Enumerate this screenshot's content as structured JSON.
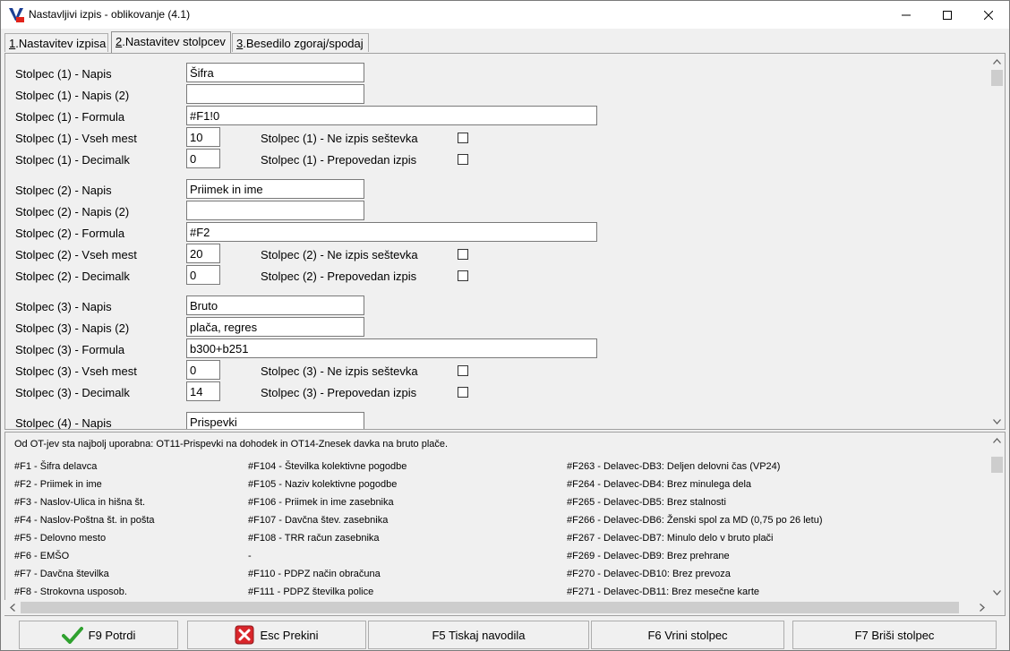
{
  "window": {
    "title": "Nastavljivi izpis - oblikovanje  (4.1)"
  },
  "tabs": [
    {
      "num": "1",
      "label": ".Nastavitev izpisa"
    },
    {
      "num": "2",
      "label": ".Nastavitev stolpcev"
    },
    {
      "num": "3",
      "label": ".Besedilo zgoraj/spodaj"
    }
  ],
  "columns": [
    {
      "napis_label": "Stolpec (1) - Napis",
      "napis": "Šifra",
      "napis2_label": "Stolpec (1) - Napis (2)",
      "napis2": "",
      "formula_label": "Stolpec (1) - Formula",
      "formula": "#F1!0",
      "mest_label": "Stolpec (1) - Vseh mest",
      "mest": "10",
      "decimalk_label": "Stolpec (1) - Decimalk",
      "decimalk": "0",
      "ne_izpis_label": "Stolpec (1) - Ne izpis seštevka",
      "prepovedan_label": "Stolpec (1) - Prepovedan izpis"
    },
    {
      "napis_label": "Stolpec (2) - Napis",
      "napis": "Priimek in ime",
      "napis2_label": "Stolpec (2) - Napis (2)",
      "napis2": "",
      "formula_label": "Stolpec (2) - Formula",
      "formula": "#F2",
      "mest_label": "Stolpec (2) - Vseh mest",
      "mest": "20",
      "decimalk_label": "Stolpec (2) - Decimalk",
      "decimalk": "0",
      "ne_izpis_label": "Stolpec (2) - Ne izpis seštevka",
      "prepovedan_label": "Stolpec (2) - Prepovedan izpis"
    },
    {
      "napis_label": "Stolpec (3) - Napis",
      "napis": "Bruto",
      "napis2_label": "Stolpec (3) - Napis (2)",
      "napis2": "plača, regres",
      "formula_label": "Stolpec (3) - Formula",
      "formula": "b300+b251",
      "mest_label": "Stolpec (3) - Vseh mest",
      "mest": "0",
      "decimalk_label": "Stolpec (3) - Decimalk",
      "decimalk": "14",
      "ne_izpis_label": "Stolpec (3) - Ne izpis seštevka",
      "prepovedan_label": "Stolpec (3) - Prepovedan izpis"
    },
    {
      "napis_label": "Stolpec (4) - Napis",
      "napis": "Prispevki"
    }
  ],
  "help": {
    "title": "Od OT-jev sta najbolj uporabna: OT11-Prispevki na dohodek in OT14-Znesek davka na bruto plače.",
    "col1": [
      "#F1 - Šifra delavca",
      "#F2 - Priimek in ime",
      "#F3 - Naslov-Ulica in hišna št.",
      "#F4 - Naslov-Poštna št. in pošta",
      "#F5 - Delovno mesto",
      "#F6 - EMŠO",
      "#F7 - Davčna številka",
      "#F8 - Strokovna usposob."
    ],
    "col2": [
      "#F104 - Številka kolektivne pogodbe",
      "#F105 - Naziv kolektivne pogodbe",
      "#F106 - Priimek in ime zasebnika",
      "#F107 - Davčna štev. zasebnika",
      "#F108 - TRR račun zasebnika",
      "-",
      "#F110 - PDPZ način obračuna",
      "#F111 - PDPZ številka police"
    ],
    "col3": [
      "#F263 - Delavec-DB3: Deljen delovni čas (VP24)",
      "#F264 - Delavec-DB4: Brez minulega dela",
      "#F265 - Delavec-DB5: Brez stalnosti",
      "#F266 - Delavec-DB6: Ženski spol za MD (0,75 po 26 letu)",
      "#F267 - Delavec-DB7: Minulo delo v bruto plači",
      "#F269 - Delavec-DB9: Brez prehrane",
      "#F270 - Delavec-DB10: Brez prevoza",
      "#F271 - Delavec-DB11: Brez mesečne karte"
    ]
  },
  "buttons": {
    "potrdi": "F9 Potrdi",
    "prekini": "Esc Prekini",
    "tiskaj": "F5 Tiskaj navodila",
    "vrini": "F6  Vrini stolpec",
    "brisi": "F7  Briši stolpec"
  },
  "colors": {
    "check_green": "#2fa12f",
    "cancel_red": "#d9262b"
  }
}
